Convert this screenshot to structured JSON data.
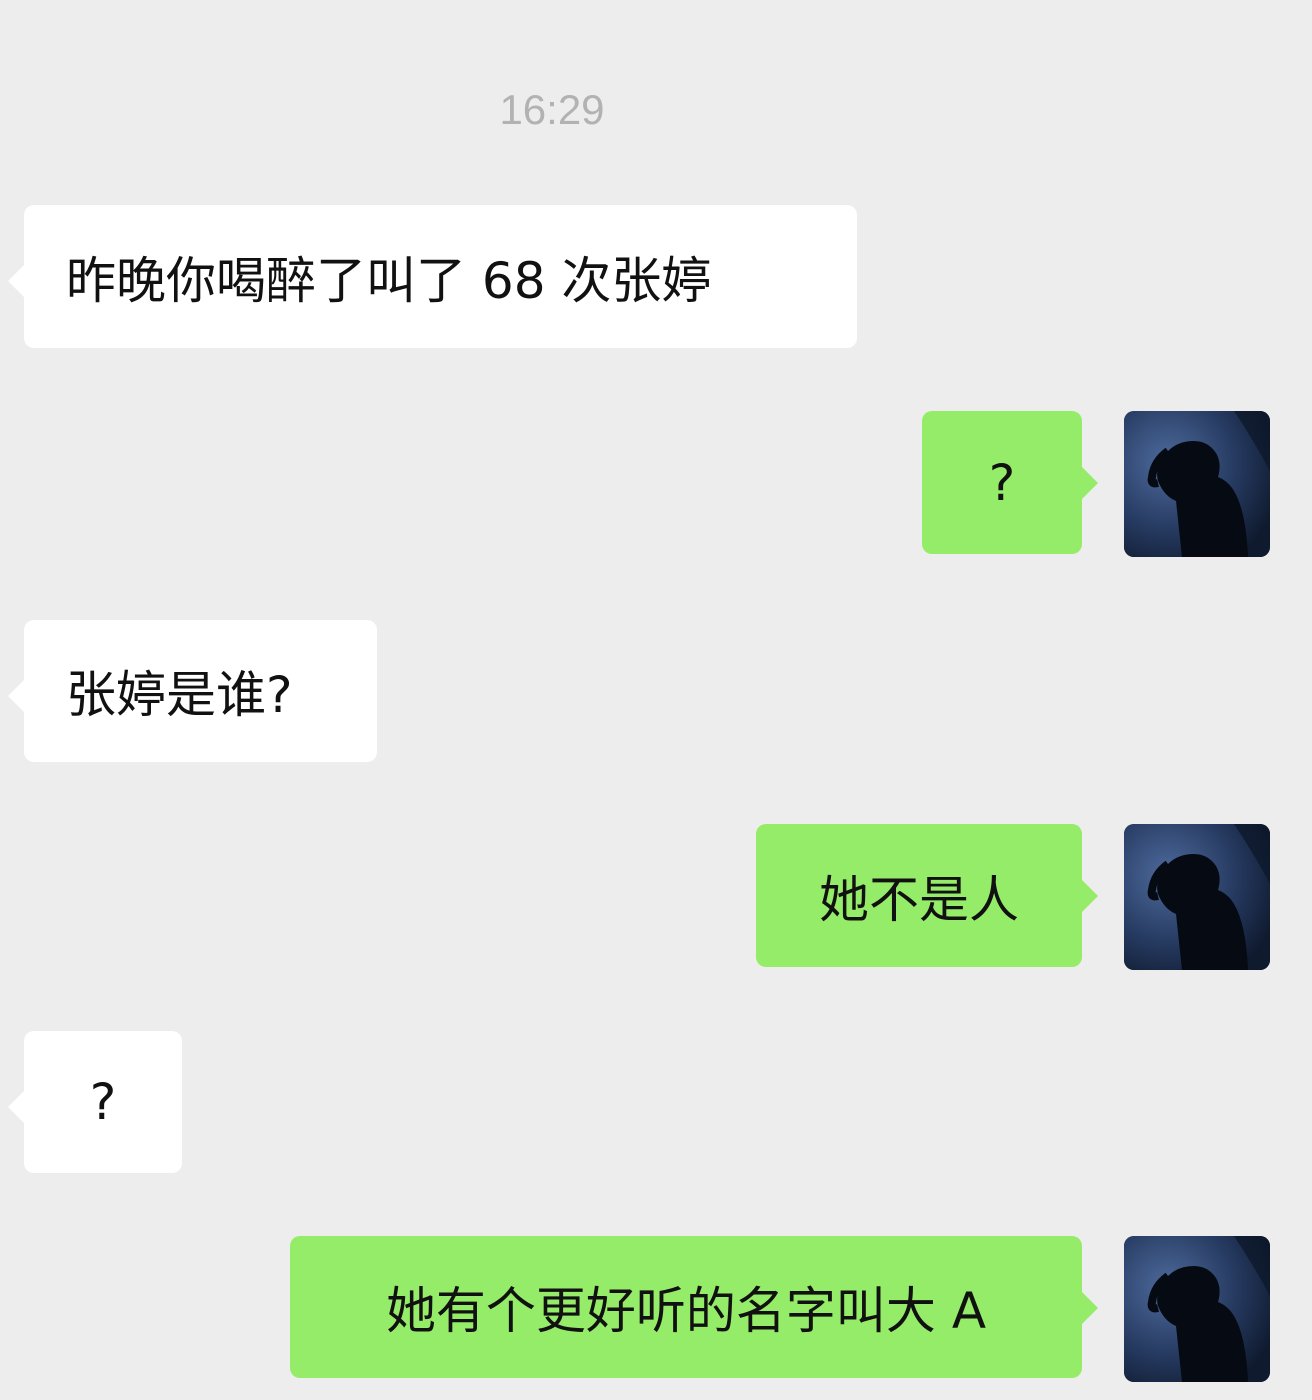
{
  "chat": {
    "timestamp": "16:29",
    "messages": [
      {
        "side": "left",
        "text": "昨晚你喝醉了叫了 68 次张婷"
      },
      {
        "side": "right",
        "text": "?"
      },
      {
        "side": "left",
        "text": "张婷是谁?"
      },
      {
        "side": "right",
        "text": "她不是人"
      },
      {
        "side": "left",
        "text": "?"
      },
      {
        "side": "right",
        "text": "她有个更好听的名字叫大 A"
      }
    ]
  },
  "colors": {
    "background": "#ededed",
    "incoming_bubble": "#ffffff",
    "outgoing_bubble": "#95ec69",
    "timestamp_text": "#b2b2b2"
  },
  "icons": {
    "avatar": "silhouette-avatar-icon"
  }
}
